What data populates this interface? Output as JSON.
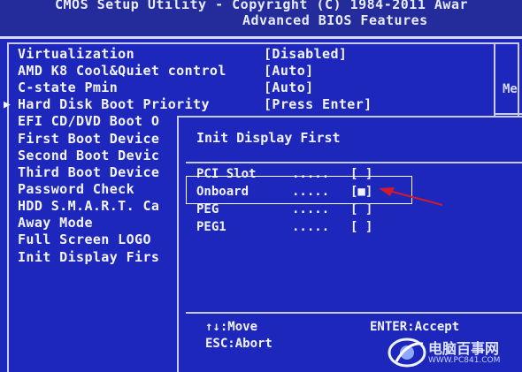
{
  "header": {
    "line1": "CMOS Setup Utility - Copyright (C) 1984-2011 Awar",
    "line2": "Advanced BIOS Features"
  },
  "right_panel": {
    "text": "Me"
  },
  "menu": {
    "items": [
      {
        "label": "Virtualization",
        "value": "[Disabled]"
      },
      {
        "label": "AMD K8 Cool&Quiet control",
        "value": "[Auto]"
      },
      {
        "label": "C-state Pmin",
        "value": "[Auto]"
      },
      {
        "label": "Hard Disk Boot Priority",
        "value": "[Press Enter]"
      },
      {
        "label": "EFI CD/DVD Boot O",
        "value": ""
      },
      {
        "label": "First Boot Device",
        "value": ""
      },
      {
        "label": "Second Boot Devic",
        "value": ""
      },
      {
        "label": "Third Boot Device",
        "value": ""
      },
      {
        "label": "Password Check",
        "value": ""
      },
      {
        "label": "HDD S.M.A.R.T. Ca",
        "value": ""
      },
      {
        "label": "Away Mode",
        "value": ""
      },
      {
        "label": "Full Screen LOGO",
        "value": ""
      },
      {
        "label": "Init Display Firs",
        "value": ""
      }
    ],
    "pointer": "▶"
  },
  "popup": {
    "title": "Init Display First",
    "options": [
      {
        "label": "PCI Slot",
        "dots": ".....",
        "box": "[ ]",
        "selected": false
      },
      {
        "label": "Onboard",
        "dots": ".....",
        "box": "[■]",
        "selected": true
      },
      {
        "label": "PEG",
        "dots": ".....",
        "box": "[ ]",
        "selected": false
      },
      {
        "label": "PEG1",
        "dots": ".....",
        "box": "[ ]",
        "selected": false
      }
    ],
    "hints": {
      "move": "↑↓:Move",
      "abort": "ESC:Abort",
      "accept": "ENTER:Accept"
    }
  },
  "watermark": {
    "name": "电脑百事网",
    "url": "WWW.PC841.COM"
  },
  "colors": {
    "background": "#1d27bb",
    "text": "#f4f4ff",
    "annotation_arrow": "#d01c2a"
  }
}
